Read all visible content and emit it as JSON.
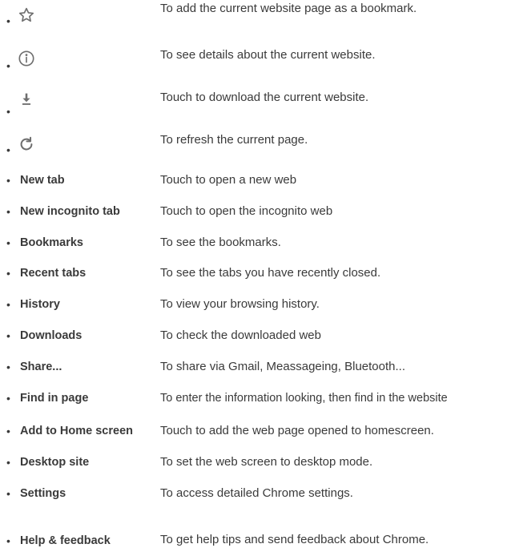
{
  "bullet_char": "•",
  "icon_rows": [
    {
      "icon": "star-icon",
      "description": "To add the current website page as a bookmark."
    },
    {
      "icon": "info-icon",
      "description": "To see details about the current website."
    },
    {
      "icon": "download-icon",
      "description": "Touch to download the current website."
    },
    {
      "icon": "refresh-icon",
      "description": "To refresh the current page."
    }
  ],
  "menu_rows": [
    {
      "label": "New tab",
      "description": "Touch to open a new web"
    },
    {
      "label": "New incognito tab",
      "description": "Touch to open the incognito web"
    },
    {
      "label": "Bookmarks",
      "description": "To see the bookmarks."
    },
    {
      "label": "Recent tabs",
      "description": "To see the tabs you have recently closed."
    },
    {
      "label": "History",
      "description": "To view your browsing history."
    },
    {
      "label": "Downloads",
      "description": "To check the downloaded web"
    },
    {
      "label": "Share...",
      "description": "To share via Gmail, Meassageing, Bluetooth..."
    },
    {
      "label": "Find in page",
      "description": "To enter the information looking, then find in the website"
    },
    {
      "label": "Add to Home screen",
      "description": "Touch to add the web page opened to homescreen."
    },
    {
      "label": "Desktop site",
      "description": "To set the web screen to desktop mode."
    },
    {
      "label": "Settings",
      "description": "To access detailed Chrome settings."
    },
    {
      "label": "Help & feedback",
      "description": "To get help tips and send feedback about Chrome."
    }
  ]
}
